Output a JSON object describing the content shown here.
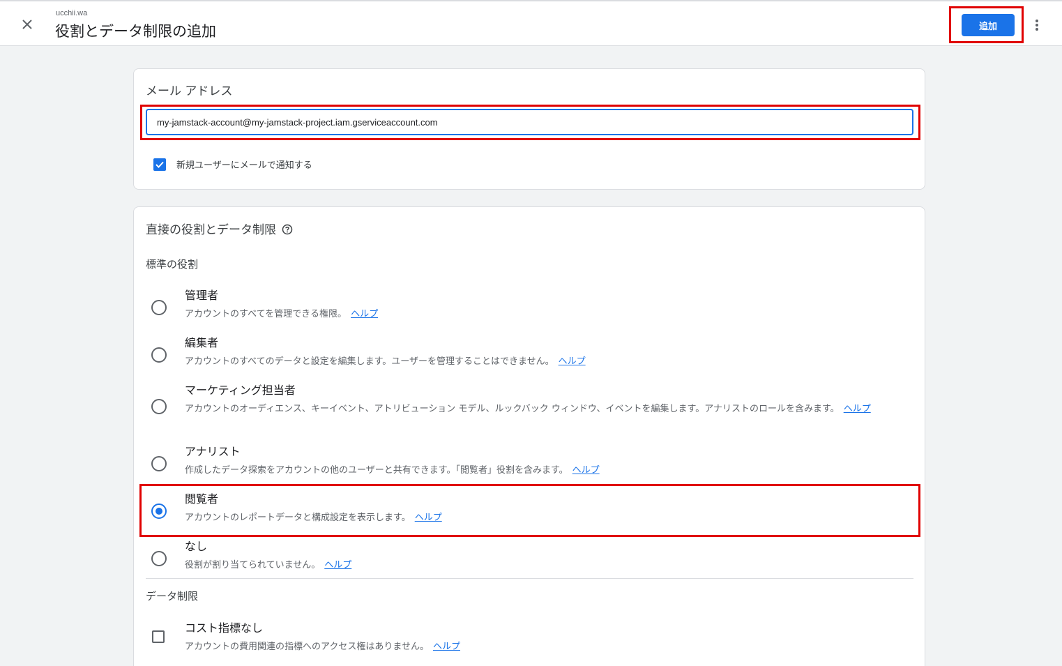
{
  "header": {
    "account_name": "ucchii.wa",
    "title": "役割とデータ制限の追加",
    "add_label": "追加"
  },
  "email_section": {
    "title": "メール アドレス",
    "email_value": "my-jamstack-account@my-jamstack-project.iam.gserviceaccount.com",
    "notify_label": "新規ユーザーにメールで通知する",
    "notify_checked": true
  },
  "roles_section": {
    "title": "直接の役割とデータ制限",
    "standard_roles_label": "標準の役割",
    "roles": [
      {
        "name": "管理者",
        "description": "アカウントのすべてを管理できる権限。",
        "help": "ヘルプ",
        "selected": false
      },
      {
        "name": "編集者",
        "description": "アカウントのすべてのデータと設定を編集します。ユーザーを管理することはできません。",
        "help": "ヘルプ",
        "selected": false
      },
      {
        "name": "マーケティング担当者",
        "description": "アカウントのオーディエンス、キーイベント、アトリビューション モデル、ルックバック ウィンドウ、イベントを編集します。アナリストのロールを含みます。",
        "help": "ヘルプ",
        "selected": false
      },
      {
        "name": "アナリスト",
        "description": "作成したデータ探索をアカウントの他のユーザーと共有できます。「閲覧者」役割を含みます。",
        "help": "ヘルプ",
        "selected": false
      },
      {
        "name": "閲覧者",
        "description": "アカウントのレポートデータと構成設定を表示します。",
        "help": "ヘルプ",
        "selected": true
      },
      {
        "name": "なし",
        "description": "役割が割り当てられていません。",
        "help": "ヘルプ",
        "selected": false
      }
    ],
    "data_restrictions_label": "データ制限",
    "restrictions": [
      {
        "name": "コスト指標なし",
        "description": "アカウントの費用関連の指標へのアクセス権はありません。",
        "help": "ヘルプ",
        "checked": false
      }
    ]
  },
  "colors": {
    "accent": "#1a73e8",
    "highlight": "#e00000",
    "background": "#f1f3f4"
  }
}
